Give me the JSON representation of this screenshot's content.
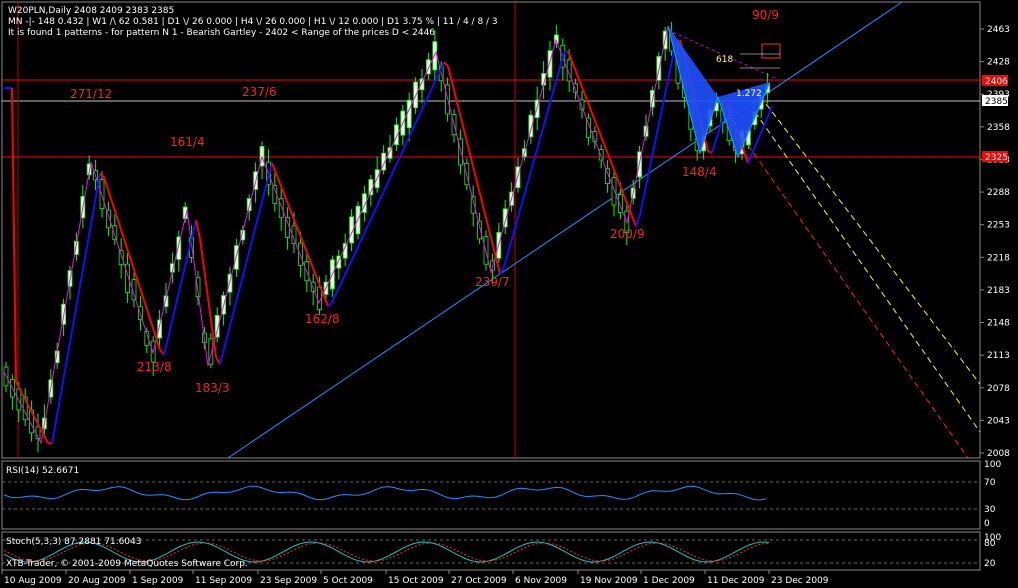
{
  "header": {
    "line1": "W20PLN,Daily  2408 2409 2383 2385",
    "line2": "MN -|- 148  0.432  |  W1 /\\ 62  0.581  |  D1 \\/ 26  0.000  |  H4 \\/ 26  0.000  |  H1 \\/ 12  0.000  |  D1  3.75 %  |  11 / 4 / 8 / 3",
    "line3": "It is found 1 patterns  -  for pattern N 1 - Bearish Gartley - 2402 < Range of the prices D < 2446"
  },
  "price_axis": {
    "ticks": [
      "2463",
      "2428",
      "2393",
      "2358",
      "2323",
      "2288",
      "2253",
      "2218",
      "2183",
      "2148",
      "2113",
      "2078",
      "2043",
      "2008"
    ],
    "levels": [
      {
        "label": "2406",
        "color": "#ff0000"
      },
      {
        "label": "2385",
        "color": "#ffffff"
      },
      {
        "label": "2325",
        "color": "#ff0000"
      }
    ]
  },
  "date_axis": [
    "10 Aug 2009",
    "20 Aug 2009",
    "1 Sep 2009",
    "11 Sep 2009",
    "23 Sep 2009",
    "5 Oct 2009",
    "15 Oct 2009",
    "27 Oct 2009",
    "6 Nov 2009",
    "19 Nov 2009",
    "1 Dec 2009",
    "11 Dec 2009",
    "23 Dec 2009"
  ],
  "annotations": {
    "a1": "271/12",
    "a2": "237/6",
    "a3": "161/4",
    "a4": "213/8",
    "a5": "183/3",
    "a6": "162/8",
    "a7": "239/7",
    "a8": "200/9",
    "a9": "148/4",
    "a10": "90/9",
    "fib1": "618",
    "fib2": "1.272"
  },
  "rsi": {
    "label": "RSI(14) 52.6671",
    "levels": [
      "70",
      "30",
      "0"
    ],
    "top_label": "100"
  },
  "stoch": {
    "label": "Stoch(5,3,3) 87.2881 71.6043",
    "levels": [
      "80",
      "20"
    ],
    "top_label": "100"
  },
  "copyright": "XTB-Trader, © 2001-2009 MetaQuotes Software Corp.",
  "chart_data": {
    "type": "line",
    "title": "W20PLN,Daily",
    "ylim": [
      2008,
      2463
    ],
    "zigzag_pivots": [
      {
        "x": "10 Aug 2009",
        "y": 2080
      },
      {
        "x": "13 Aug 2009",
        "y": 2020
      },
      {
        "x": "18 Aug 2009",
        "y": 2318
      },
      {
        "x": "28 Aug 2009",
        "y": 2118
      },
      {
        "x": "3 Sep 2009",
        "y": 2268
      },
      {
        "x": "9 Sep 2009",
        "y": 2098
      },
      {
        "x": "21 Sep 2009",
        "y": 2318
      },
      {
        "x": "1 Oct 2009",
        "y": 2168
      },
      {
        "x": "21 Oct 2009",
        "y": 2437
      },
      {
        "x": "3 Nov 2009",
        "y": 2208
      },
      {
        "x": "13 Nov 2009",
        "y": 2450
      },
      {
        "x": "25 Nov 2009",
        "y": 2258
      },
      {
        "x": "4 Dec 2009",
        "y": 2464
      },
      {
        "x": "11 Dec 2009",
        "y": 2333
      },
      {
        "x": "15 Dec 2009",
        "y": 2384
      },
      {
        "x": "17 Dec 2009",
        "y": 2330
      },
      {
        "x": "22 Dec 2009",
        "y": 2404
      }
    ],
    "last_ohlc": {
      "open": 2408,
      "high": 2409,
      "low": 2383,
      "close": 2385
    },
    "rsi_last": 52.6671,
    "stoch_last": [
      87.2881,
      71.6043
    ]
  }
}
